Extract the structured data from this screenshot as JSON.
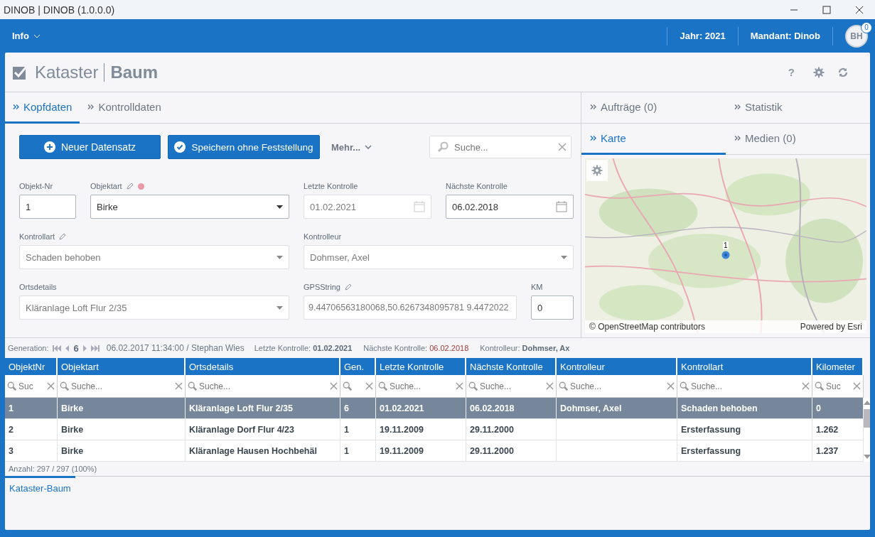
{
  "window": {
    "title": "DINOB | DINOB (1.0.0.0)"
  },
  "header": {
    "menu": "Info",
    "year": "Jahr: 2021",
    "client": "Mandant: Dinob",
    "avatar": "BH",
    "badge": "0"
  },
  "page": {
    "title_light": "Kataster",
    "title_bold": "Baum",
    "help": "?"
  },
  "tabs": [
    {
      "label": "Kopfdaten",
      "selected": true
    },
    {
      "label": "Kontrolldaten",
      "selected": false
    }
  ],
  "toolbar": {
    "new_button": "Neuer Datensatz",
    "save_button": "Speichern ohne Feststellung",
    "more": "Mehr...",
    "search_placeholder": "Suche..."
  },
  "fields": [
    {
      "label": "Objekt-Nr",
      "kind": "text",
      "value": "1",
      "editable": false,
      "required": false,
      "disabled": false
    },
    {
      "label": "Objektart",
      "kind": "select",
      "value": "Birke",
      "editable": true,
      "required": true,
      "disabled": false
    },
    {
      "label": "Letzte Kontrolle",
      "kind": "date",
      "value": "01.02.2021",
      "editable": false,
      "required": false,
      "disabled": true
    },
    {
      "label": "Nächste Kontrolle",
      "kind": "date",
      "value": "06.02.2018",
      "editable": false,
      "required": false,
      "disabled": false
    },
    {
      "label": "Kontrollart",
      "kind": "select",
      "value": "Schaden behoben",
      "editable": true,
      "required": false,
      "disabled": true
    },
    {
      "label": "Kontrolleur",
      "kind": "select",
      "value": "Dohmser, Axel",
      "editable": false,
      "required": false,
      "disabled": true
    },
    {
      "label": "Ortsdetails",
      "kind": "select",
      "value": "Kläranlage Loft  Flur 2/35",
      "editable": false,
      "required": false,
      "disabled": true
    },
    {
      "label": "GPSString",
      "kind": "text",
      "value": "9.44706563180068,50.6267348095781 9.4472022",
      "editable": true,
      "required": false,
      "disabled": true
    },
    {
      "label": "KM",
      "kind": "text",
      "value": "0",
      "editable": false,
      "required": false,
      "disabled": false
    }
  ],
  "right_tabs": [
    {
      "label": "Aufträge (0)",
      "selected": false
    },
    {
      "label": "Statistik",
      "selected": false
    }
  ],
  "map_tabs": [
    {
      "label": "Karte",
      "selected": true
    },
    {
      "label": "Medien (0)",
      "selected": false
    }
  ],
  "map": {
    "kind": "picture",
    "marker_label": "1",
    "attribution": "© OpenStreetMap contributors",
    "powered": "Powered by Esri"
  },
  "generation": {
    "label": "Generation:",
    "number": "6",
    "stamp": "06.02.2017 11:34:00 / Stephan Wies",
    "items": [
      {
        "label": "Letzte Kontrolle:",
        "value": "01.02.2021",
        "highlight": false
      },
      {
        "label": "Nächste Kontrolle:",
        "value": "06.02.2018",
        "highlight": true
      },
      {
        "label": "Kontrolleur:",
        "value": "Dohmser, Ax",
        "highlight": false
      }
    ]
  },
  "table": {
    "columns": [
      "ObjektNr",
      "Objektart",
      "Ortsdetails",
      "Gen.",
      "Letzte Kontrolle",
      "Nächste Kontrolle",
      "Kontrolleur",
      "Kontrollart",
      "Kilometer"
    ],
    "filters": [
      {
        "kind": "search",
        "placeholder": "Suc"
      },
      {
        "kind": "search",
        "placeholder": "Suche..."
      },
      {
        "kind": "search",
        "placeholder": "Suche..."
      },
      {
        "kind": "search"
      },
      {
        "kind": "search",
        "placeholder": "Suche..."
      },
      {
        "kind": "search",
        "placeholder": "Suche..."
      },
      {
        "kind": "search",
        "placeholder": "Suche..."
      },
      {
        "kind": "search",
        "placeholder": "Suche..."
      },
      {
        "kind": "search",
        "placeholder": "Suc"
      }
    ],
    "rows": [
      {
        "selected": true,
        "cells": [
          "1",
          "Birke",
          "Kläranlage Loft  Flur 2/35",
          "6",
          "01.02.2021",
          "06.02.2018",
          "Dohmser, Axel",
          "Schaden behoben",
          "0"
        ]
      },
      {
        "selected": false,
        "cells": [
          "2",
          "Birke",
          "Kläranlage Dorf  Flur 4/23",
          "1",
          "19.11.2009",
          "29.11.2000",
          "",
          "Ersterfassung",
          "1.262"
        ]
      },
      {
        "selected": false,
        "cells": [
          "3",
          "Birke",
          "Kläranlage Hausen  Hochbehäl",
          "1",
          "19.11.2009",
          "29.11.2000",
          "",
          "Ersterfassung",
          "1.237"
        ]
      }
    ],
    "count": "Anzahl: 297 / 297 (100%)"
  },
  "bottom_tabs": [
    {
      "label": "Kataster-Baum",
      "selected": true
    }
  ]
}
